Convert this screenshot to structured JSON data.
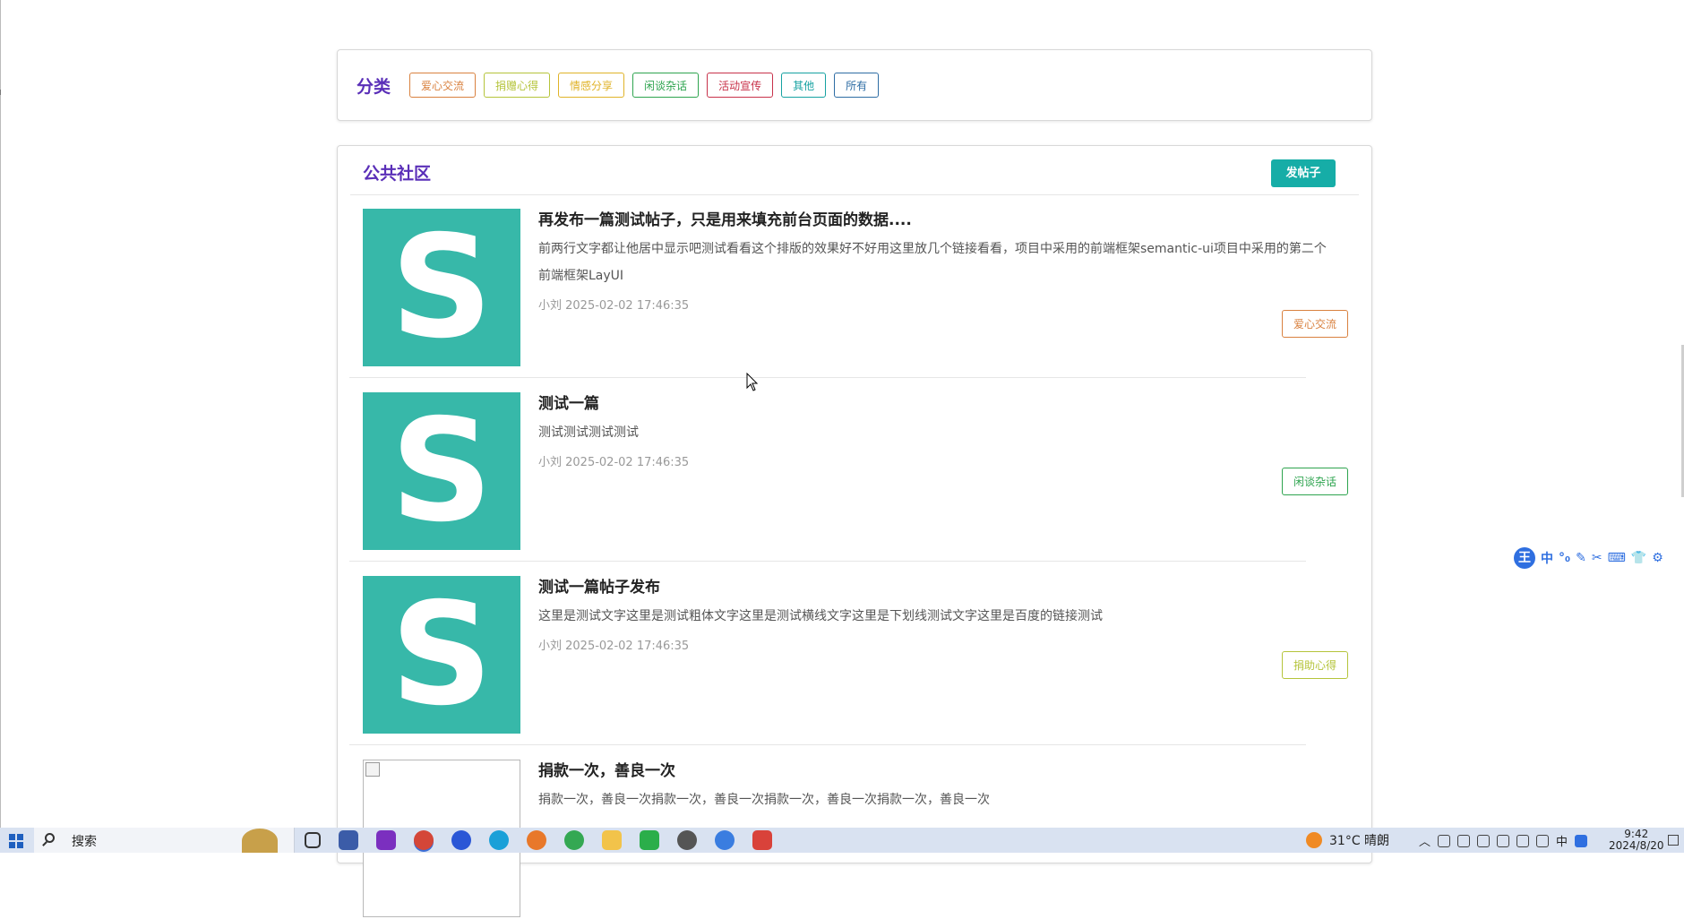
{
  "categories": {
    "title": "分类",
    "tags": [
      {
        "label": "爱心交流",
        "color": "#d9813f"
      },
      {
        "label": "捐赠心得",
        "color": "#b5c43b"
      },
      {
        "label": "情感分享",
        "color": "#e0b328"
      },
      {
        "label": "闲谈杂话",
        "color": "#2ea44f"
      },
      {
        "label": "活动宣传",
        "color": "#c8324a"
      },
      {
        "label": "其他",
        "color": "#16a2a2"
      },
      {
        "label": "所有",
        "color": "#2e6da4"
      }
    ]
  },
  "community": {
    "title": "公共社区",
    "post_button": "发帖子",
    "posts": [
      {
        "thumb_letter": "S",
        "title": "再发布一篇测试帖子，只是用来填充前台页面的数据....",
        "excerpt": "前两行文字都让他居中显示吧测试看看这个排版的效果好不好用这里放几个链接看看，项目中采用的前端框架semantic-ui项目中采用的第二个前端框架LayUI",
        "meta": "小刘 2025-02-02 17:46:35",
        "tag": "爱心交流",
        "tag_color": "#d9813f"
      },
      {
        "thumb_letter": "S",
        "title": "测试一篇",
        "excerpt": "测试测试测试测试",
        "meta": "小刘 2025-02-02 17:46:35",
        "tag": "闲谈杂话",
        "tag_color": "#2ea44f"
      },
      {
        "thumb_letter": "S",
        "title": "测试一篇帖子发布",
        "excerpt": "这里是测试文字这里是测试粗体文字这里是测试横线文字这里是下划线测试文字这里是百度的链接测试",
        "meta": "小刘 2025-02-02 17:46:35",
        "tag": "捐助心得",
        "tag_color": "#b5c43b"
      },
      {
        "thumb_letter": "",
        "title": "捐款一次，善良一次",
        "excerpt": "捐款一次，善良一次捐款一次，善良一次捐款一次，善良一次捐款一次，善良一次",
        "meta": "",
        "tag": "",
        "tag_color": ""
      }
    ]
  },
  "ime": {
    "logo": "王",
    "items": [
      "中",
      "°₀",
      "✎",
      "✂",
      "⌨",
      "👕",
      "⚙"
    ]
  },
  "taskbar": {
    "search_label": "搜索",
    "weather": "31°C  晴朗",
    "ime_mode": "中",
    "clock_time": "9:42",
    "clock_date": "2024/8/20"
  }
}
